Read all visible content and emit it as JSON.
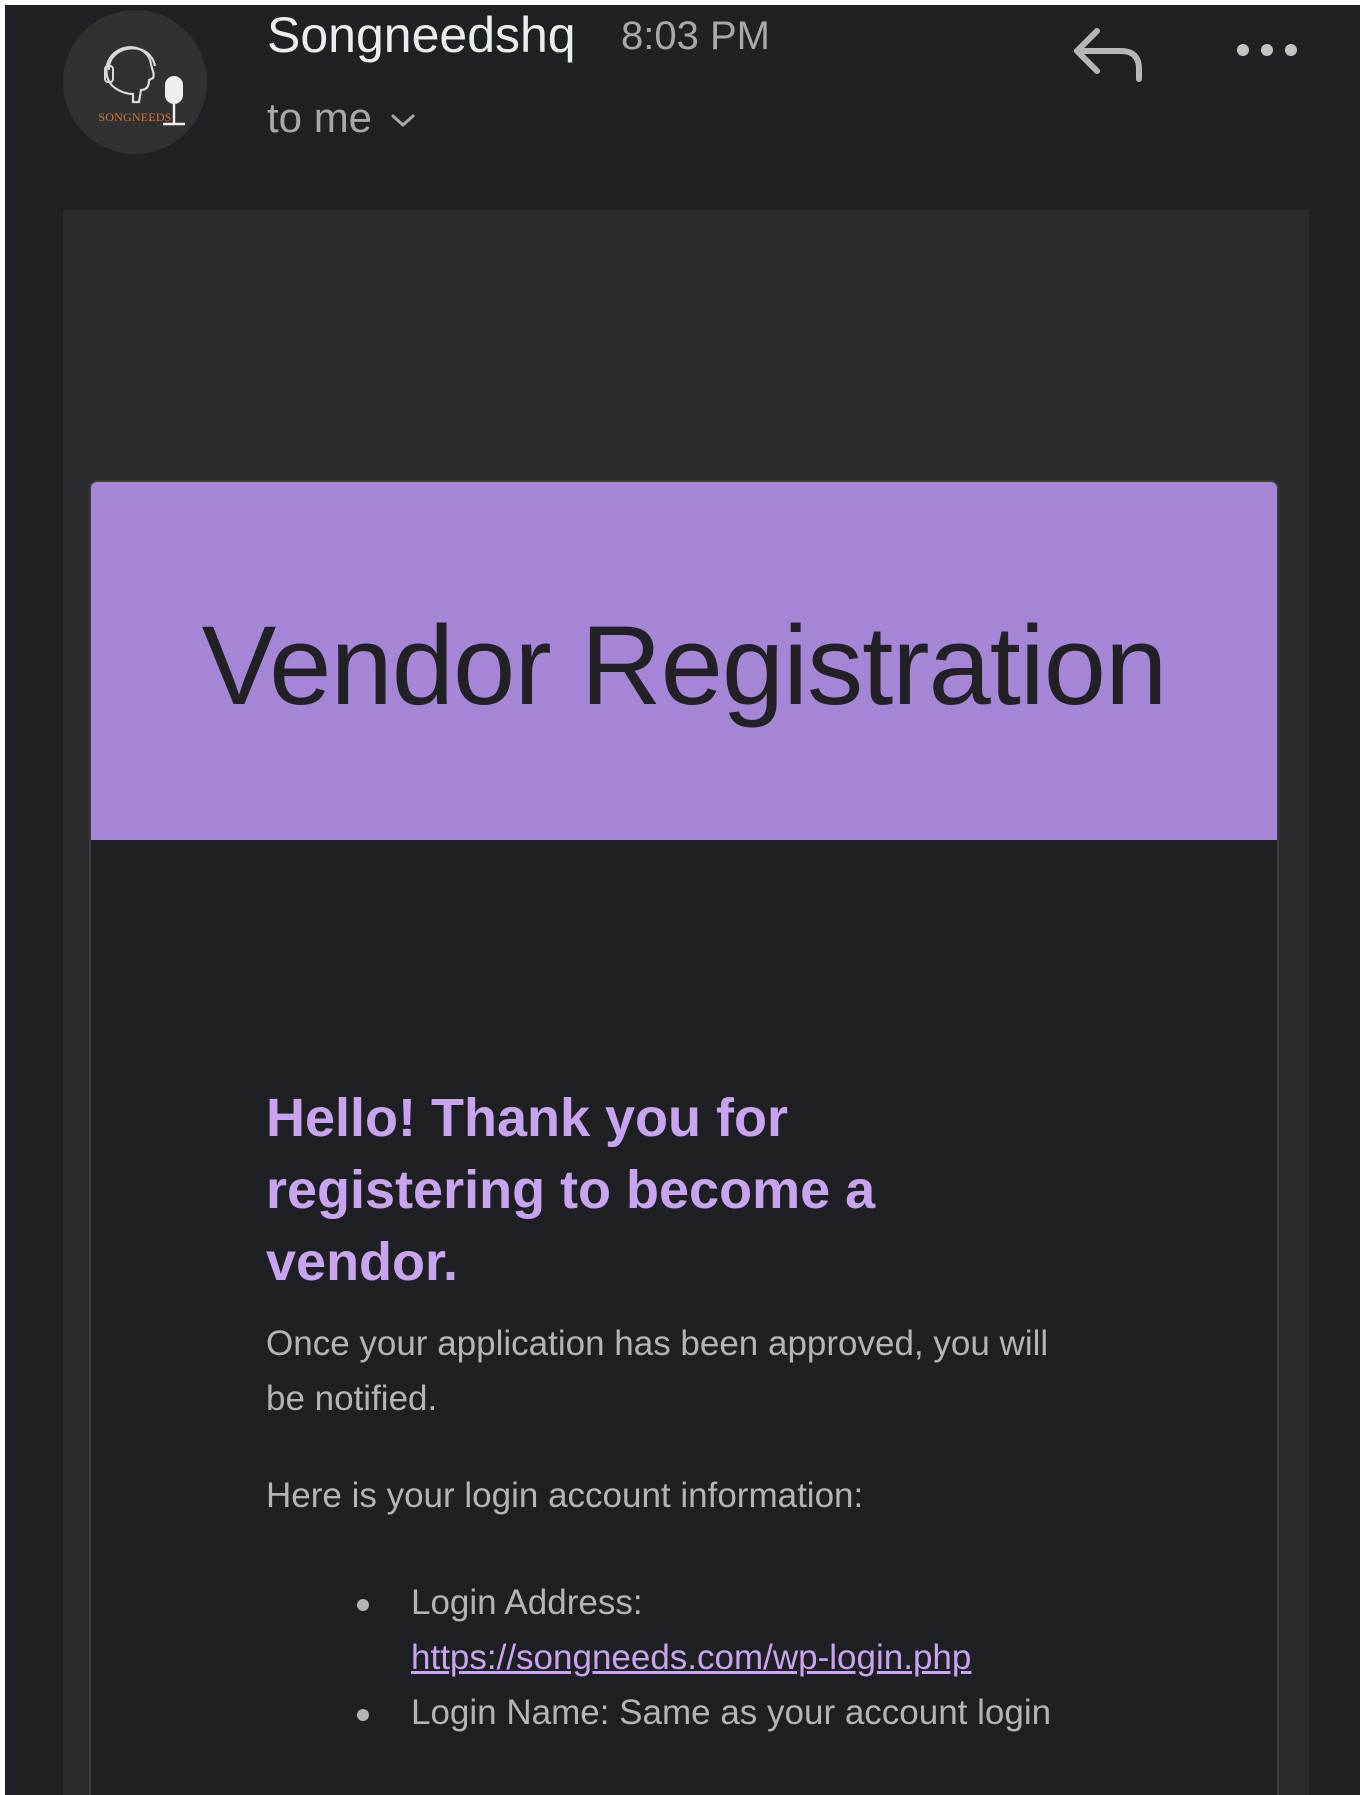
{
  "header": {
    "sender": "Songneedshq",
    "time": "8:03 PM",
    "recipient": "to me",
    "avatar_logo_text": "SONGNEEDS",
    "reply_icon": "reply-icon",
    "more_icon": "more-horizontal-icon",
    "chevron_icon": "chevron-down-icon"
  },
  "email": {
    "banner_title": "Vendor Registration",
    "heading": "Hello! Thank you for registering to become a vendor.",
    "paragraph_1": "Once your application has been approved, you will be notified.",
    "paragraph_2": "Here is your login account information:",
    "login_items": [
      {
        "label": "Login Address:",
        "link": "https://songneeds.com/wp-login.php"
      },
      {
        "label": "Login Name: Same as your account login"
      }
    ]
  },
  "colors": {
    "background": "#202124",
    "banner": "#a586d6",
    "heading": "#c8a4f0",
    "body_text": "#b3b4b7",
    "logo_accent": "#d9752b"
  }
}
